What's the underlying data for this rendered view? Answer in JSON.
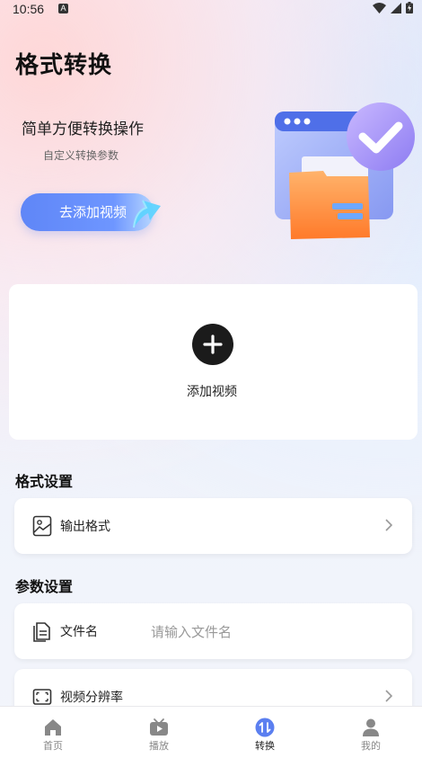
{
  "status": {
    "time": "10:56",
    "indicator": "A"
  },
  "page": {
    "title": "格式转换"
  },
  "hero": {
    "title": "简单方便转换操作",
    "subtitle": "自定义转换参数",
    "button_label": "去添加视频"
  },
  "add_video": {
    "label": "添加视频"
  },
  "format_section": {
    "title": "格式设置",
    "output_format_label": "输出格式"
  },
  "params_section": {
    "title": "参数设置",
    "filename_label": "文件名",
    "filename_placeholder": "请输入文件名",
    "filename_value": "",
    "resolution_label": "视频分辨率"
  },
  "tabbar": {
    "tabs": [
      {
        "label": "首页",
        "icon": "home-icon"
      },
      {
        "label": "播放",
        "icon": "play-icon"
      },
      {
        "label": "转换",
        "icon": "convert-icon",
        "active": true
      },
      {
        "label": "我的",
        "icon": "profile-icon"
      }
    ]
  },
  "colors": {
    "accent": "#5f86f7",
    "active_tab": "#5b7ff0"
  }
}
